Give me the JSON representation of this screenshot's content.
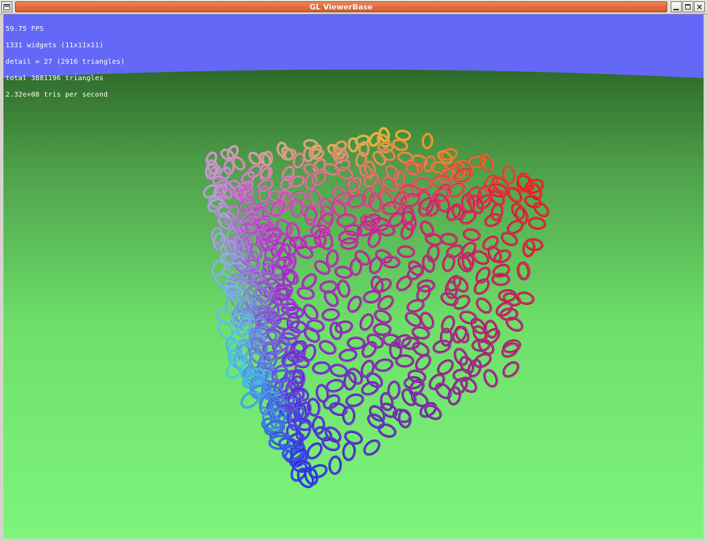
{
  "window": {
    "title": "GL ViewerBase",
    "buttons": [
      "minimize",
      "maximize",
      "close"
    ]
  },
  "overlay": {
    "stats": [
      "59.75 FPS",
      "1331 widgets (11x11x11)",
      "detail = 27 (2916 triangles)",
      "total 3881196 triangles",
      "2.32e+08 tris per second"
    ]
  },
  "scene": {
    "sky_color": "#6468f6",
    "ground_far_color": "#2f6a2c",
    "ground_near_color": "#7ef47c",
    "object": "cube of 11x11x11 tori colored by position (RGB)",
    "corner_colors": {
      "top_left": "#c28cc0",
      "top_back": "#e0b020",
      "top_right": "#e01414",
      "front_left": "#38c8e0",
      "front_center": "#b020c0",
      "front_right": "#a01870",
      "bottom": "#1e28e0"
    }
  },
  "icons": {
    "system_menu": "window-menu-icon",
    "minimize": "minimize-icon",
    "maximize": "maximize-icon",
    "close": "close-icon"
  }
}
